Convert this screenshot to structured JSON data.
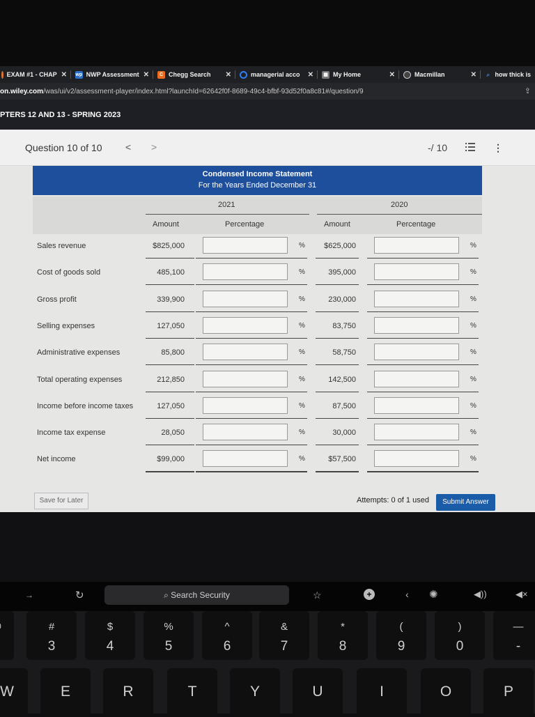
{
  "browser": {
    "tabs": [
      {
        "title": "EXAM #1 - CHAP",
        "favicon_color": "#e2742b",
        "icon": "hexagon-icon"
      },
      {
        "title": "NWP Assessment",
        "favicon_color": "#2a6fc9",
        "icon": "wp-icon"
      },
      {
        "title": "Chegg Search",
        "favicon_color": "#e86b1f",
        "icon": "chegg-icon"
      },
      {
        "title": "managerial acco",
        "favicon_color": "#2d7ff9",
        "icon": "search-q-icon"
      },
      {
        "title": "My Home",
        "favicon_color": "#7a7a7a",
        "icon": "home-grid-icon"
      },
      {
        "title": "Macmillan",
        "favicon_color": "#444444",
        "icon": "macmillan-icon"
      },
      {
        "title": "how thick is",
        "favicon_color": "#3a7bd5",
        "icon": "search-icon"
      }
    ],
    "url_host": "on.wiley.com",
    "url_path": "/was/ui/v2/assessment-player/index.html?launchId=62642f0f-8689-49c4-bfbf-93d52f0a8c81#/question/9"
  },
  "page_header": {
    "title": "PTERS 12 AND 13 - SPRING 2023"
  },
  "question_bar": {
    "title": "Question 10 of 10",
    "prev": "<",
    "next": ">",
    "score": "-/ 10"
  },
  "statement": {
    "title": "Condensed Income Statement",
    "subtitle": "For the Years Ended December 31",
    "year_2021": "2021",
    "year_2020": "2020",
    "col_amount": "Amount",
    "col_percentage": "Percentage",
    "pct_symbol": "%",
    "rows": [
      {
        "label": "Sales revenue",
        "amt_2021": "$825,000",
        "amt_2020": "$625,000"
      },
      {
        "label": "Cost of goods sold",
        "amt_2021": "485,100",
        "amt_2020": "395,000"
      },
      {
        "label": "Gross profit",
        "amt_2021": "339,900",
        "amt_2020": "230,000"
      },
      {
        "label": "Selling expenses",
        "amt_2021": "127,050",
        "amt_2020": "83,750"
      },
      {
        "label": "Administrative expenses",
        "amt_2021": "85,800",
        "amt_2020": "58,750"
      },
      {
        "label": "Total operating expenses",
        "amt_2021": "212,850",
        "amt_2020": "142,500"
      },
      {
        "label": "Income before income taxes",
        "amt_2021": "127,050",
        "amt_2020": "87,500"
      },
      {
        "label": "Income tax expense",
        "amt_2021": "28,050",
        "amt_2020": "30,000"
      },
      {
        "label": "Net income",
        "amt_2021": "$99,000",
        "amt_2020": "$57,500"
      }
    ]
  },
  "footer": {
    "save_label": "Save for Later",
    "attempts": "Attempts: 0 of 1 used",
    "submit_label": "Submit Answer"
  },
  "touchbar": {
    "search_label": "Search Security"
  },
  "keys": {
    "k3": {
      "sym": "#",
      "num": "3"
    },
    "k4": {
      "sym": "$",
      "num": "4"
    },
    "k5": {
      "sym": "%",
      "num": "5"
    },
    "k6": {
      "sym": "^",
      "num": "6"
    },
    "k7": {
      "sym": "&",
      "num": "7"
    },
    "k8": {
      "sym": "*",
      "num": "8"
    },
    "k9": {
      "sym": "(",
      "num": "9"
    },
    "k0": {
      "sym": ")",
      "num": "0"
    },
    "W": "W",
    "E": "E",
    "R": "R",
    "T": "T",
    "Y": "Y",
    "U": "U",
    "I": "I",
    "O": "O",
    "P": "P"
  }
}
